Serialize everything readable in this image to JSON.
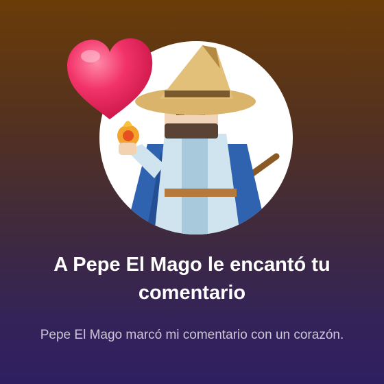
{
  "notification": {
    "title": "A Pepe El Mago le encantó tu comentario",
    "subtitle": "Pepe El Mago marcó mi comentario con un corazón."
  },
  "avatar": {
    "icon": "wizard-avatar"
  },
  "reaction": {
    "icon": "heart-icon",
    "color": "#e8275a"
  },
  "colors": {
    "background_top": "#6a3c08",
    "background_bottom": "#2e1f60",
    "title_text": "#ffffff",
    "subtitle_text": "#cdc7d6"
  }
}
